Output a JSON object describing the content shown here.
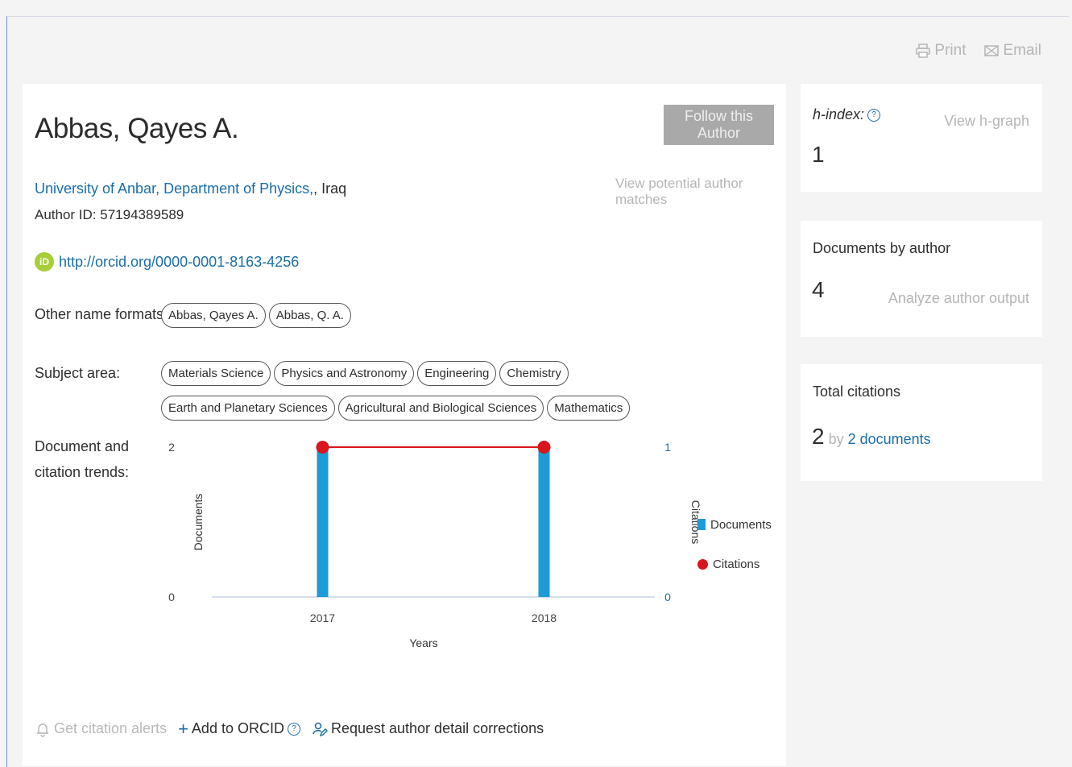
{
  "toolbar": {
    "print_label": "Print",
    "email_label": "Email"
  },
  "author": {
    "name": "Abbas, Qayes A.",
    "follow_label": "Follow this Author",
    "potential_matches_label": "View potential author matches",
    "affiliation": "University of Anbar, Department of Physics,",
    "affiliation_country": ", Iraq",
    "author_id": "Author ID: 57194389589",
    "orcid_url": "http://orcid.org/0000-0001-8163-4256",
    "orcid_badge": "iD"
  },
  "name_formats": {
    "label": "Other name formats:",
    "items": [
      "Abbas, Qayes A.",
      "Abbas, Q. A."
    ]
  },
  "subject_area": {
    "label": "Subject area:",
    "items": [
      "Materials Science",
      "Physics and Astronomy",
      "Engineering",
      "Chemistry",
      "Earth and Planetary Sciences",
      "Agricultural and Biological Sciences",
      "Mathematics"
    ]
  },
  "trends": {
    "label_line1": "Document and",
    "label_line2": "citation trends:"
  },
  "chart_data": {
    "type": "bar",
    "categories": [
      "2017",
      "2018"
    ],
    "series": [
      {
        "name": "Documents",
        "type": "bar",
        "axis": "left",
        "values": [
          2,
          2
        ],
        "color": "#1d9bd6"
      },
      {
        "name": "Citations",
        "type": "line",
        "axis": "right",
        "values": [
          1,
          1
        ],
        "color": "#d9151d"
      }
    ],
    "xlabel": "Years",
    "ylabel": "Documents",
    "ylabel_right": "Citations",
    "ylim": [
      0,
      2
    ],
    "ylim_right": [
      0,
      1
    ],
    "y_ticks": [
      "0",
      "2"
    ],
    "y_ticks_right": [
      "0",
      "1"
    ],
    "legend": "right"
  },
  "actions": {
    "alerts_label": "Get citation alerts",
    "add_orcid_label": "Add to ORCID",
    "corrections_label": "Request author detail corrections",
    "help_glyph": "?"
  },
  "metrics": {
    "h_index_label": "h-index:",
    "h_index_value": "1",
    "h_graph_link": "View h-graph",
    "help_glyph": "?",
    "documents_label": "Documents by author",
    "documents_value": "4",
    "analyze_link": "Analyze author output",
    "citations_label": "Total citations",
    "citations_value": "2",
    "citations_by": "by",
    "citations_docs": "2 documents"
  }
}
